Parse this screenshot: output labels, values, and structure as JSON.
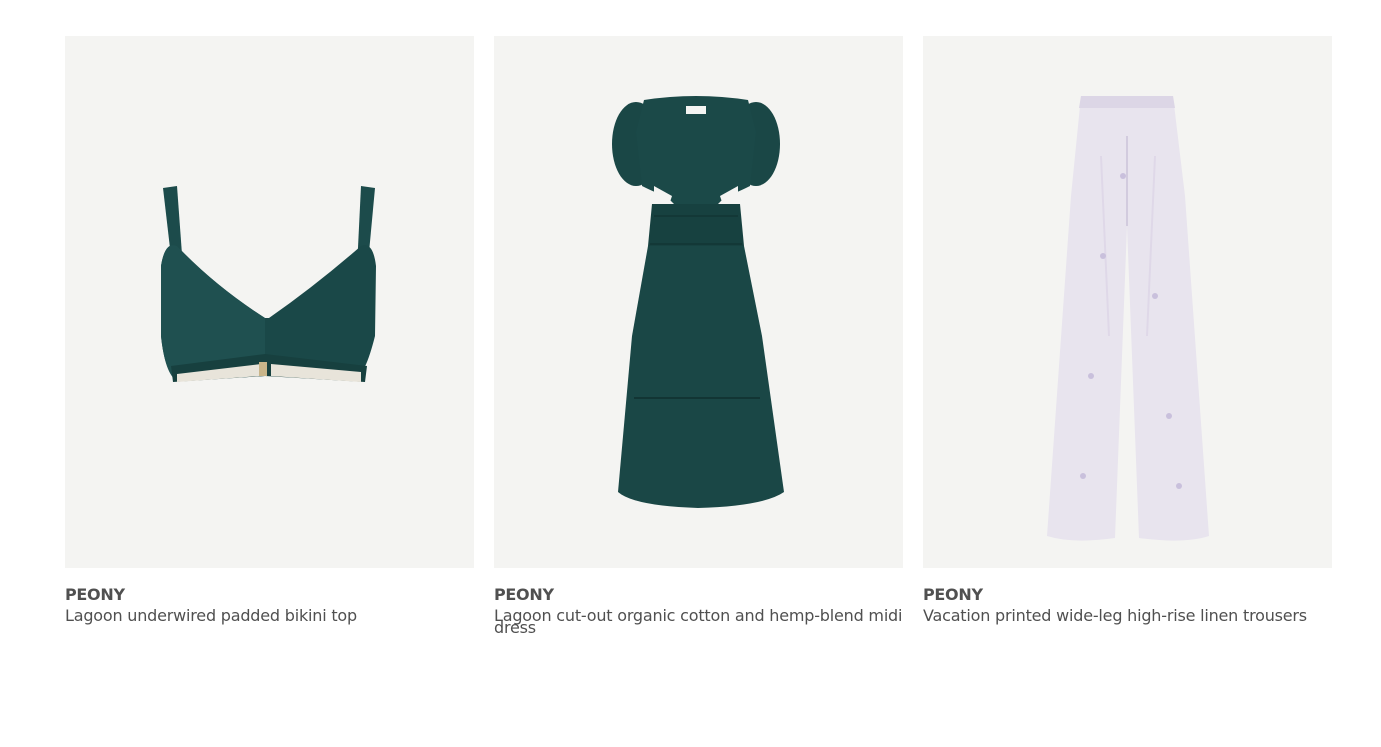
{
  "products": [
    {
      "brand": "PEONY",
      "name": "Lagoon underwired padded bikini top",
      "image_icon": "bikini-top-image",
      "image_color": "#1c4a4a"
    },
    {
      "brand": "PEONY",
      "name": "Lagoon cut-out organic cotton and hemp-blend midi dress",
      "image_icon": "midi-dress-image",
      "image_color": "#1a4645"
    },
    {
      "brand": "PEONY",
      "name": "Vacation printed wide-leg high-rise linen trousers",
      "image_icon": "wide-leg-trousers-image",
      "image_color": "#e6e2ec"
    }
  ]
}
